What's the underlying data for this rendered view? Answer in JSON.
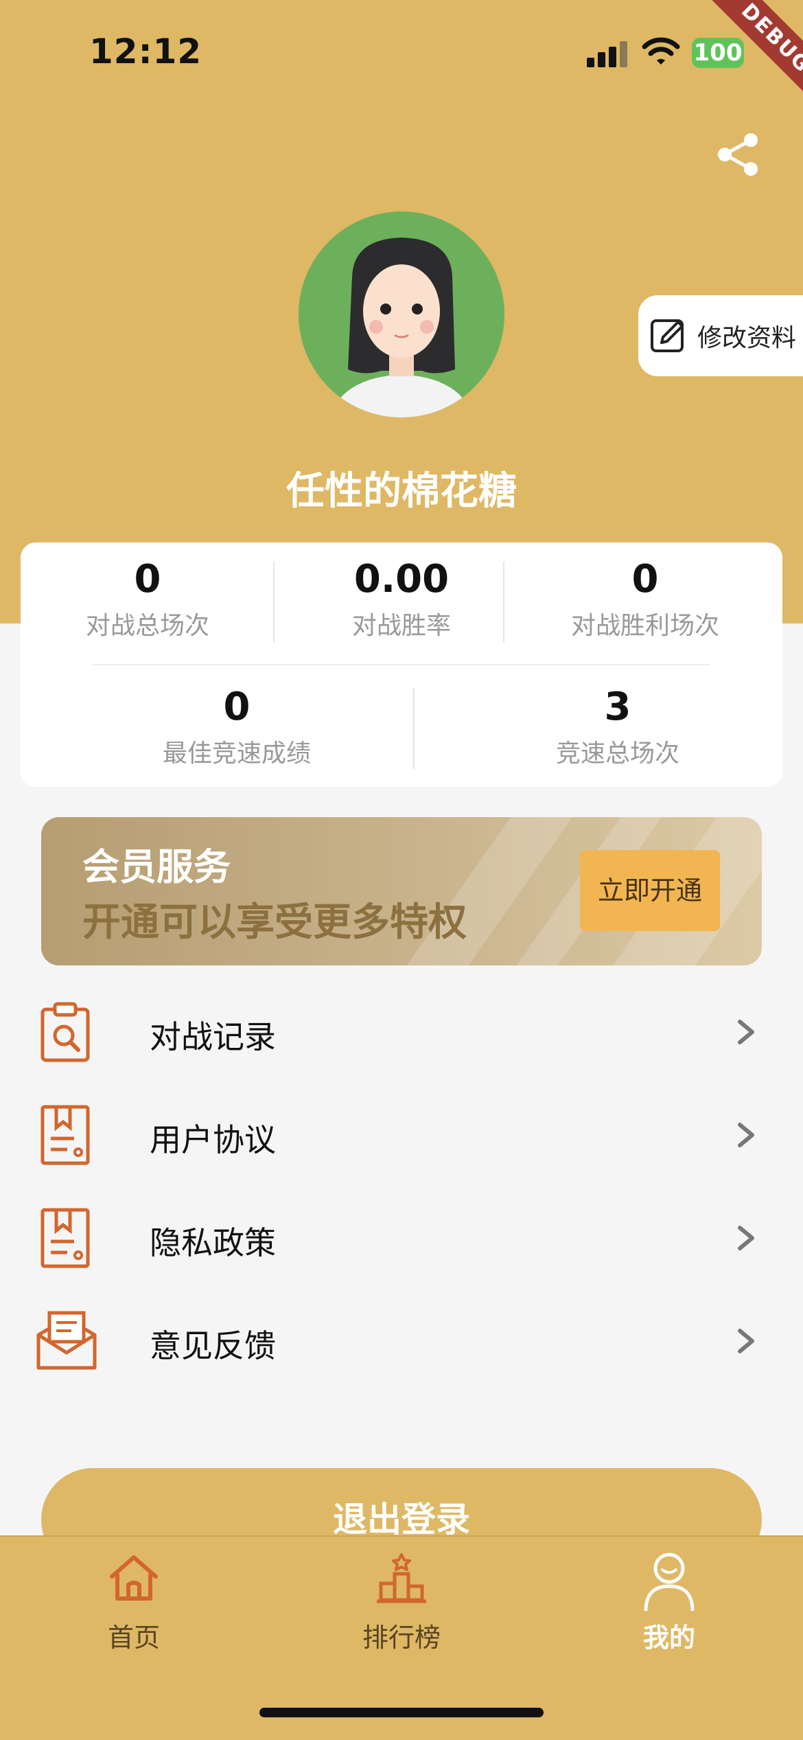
{
  "status_bar": {
    "time": "12:12",
    "battery": "100"
  },
  "debug_ribbon": "DEBUG",
  "profile": {
    "username": "任性的棉花糖",
    "edit_label": "修改资料"
  },
  "stats": {
    "row1": [
      {
        "value": "0",
        "label": "对战总场次"
      },
      {
        "value": "0.00",
        "label": "对战胜率"
      },
      {
        "value": "0",
        "label": "对战胜利场次"
      }
    ],
    "row2": [
      {
        "value": "0",
        "label": "最佳竞速成绩"
      },
      {
        "value": "3",
        "label": "竞速总场次"
      }
    ]
  },
  "member": {
    "title": "会员服务",
    "subtitle": "开通可以享受更多特权",
    "button": "立即开通"
  },
  "menu": [
    {
      "label": "对战记录",
      "icon": "clipboard-search-icon"
    },
    {
      "label": "用户协议",
      "icon": "document-bookmark-icon"
    },
    {
      "label": "隐私政策",
      "icon": "document-bookmark-icon"
    },
    {
      "label": "意见反馈",
      "icon": "envelope-icon"
    }
  ],
  "logout_label": "退出登录",
  "tabs": [
    {
      "label": "首页",
      "icon": "home-icon",
      "active": false
    },
    {
      "label": "排行榜",
      "icon": "podium-icon",
      "active": false
    },
    {
      "label": "我的",
      "icon": "user-icon",
      "active": true
    }
  ],
  "colors": {
    "header": "#deb865",
    "icon_accent": "#d2662e",
    "button_gold": "#f1b552"
  }
}
